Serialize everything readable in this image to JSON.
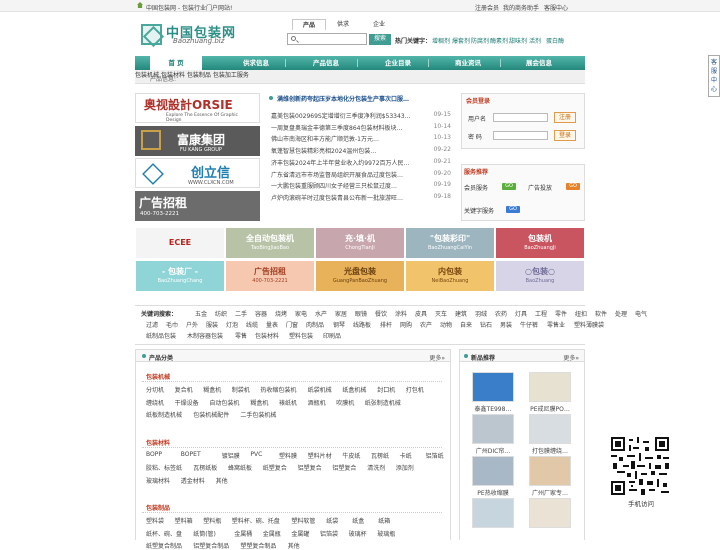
{
  "topbar": {
    "welcome": "中国包装网 - 包装行业门户网站!",
    "links": [
      "注册会员",
      "我的商务助手",
      "客服中心"
    ]
  },
  "logo": {
    "cn": "中国包装网",
    "en": "Baozhuang.biz"
  },
  "search": {
    "tabs": [
      "产品",
      "供求",
      "企业"
    ],
    "placeholder": "",
    "button": "搜索",
    "hot_label": "热门关键字：",
    "hot_words": [
      "增稠剂",
      "爆套剂",
      "防腐剂",
      "酶素剂",
      "甜味剂",
      "活剂",
      "蛋白酶"
    ]
  },
  "nav": [
    "首 页",
    "供求信息",
    "产品信息",
    "企业目录",
    "商业资讯",
    "展会信息"
  ],
  "subnav": {
    "label": "产品信息:",
    "items": [
      "包装机械",
      "包装材料",
      "包装制品",
      "包装加工服务"
    ]
  },
  "ads": [
    {
      "brand": "奥视設計ORSIE",
      "sub": "Explore The Essence Of Graphic Design",
      "bg": "#ffffff",
      "color": "#b0302a"
    },
    {
      "brand": "富康集团",
      "sub": "FU KANG GROUP",
      "bg": "#5a5a5a",
      "color": "#ffffff"
    },
    {
      "brand": "创立信",
      "sub": "WWW.CLXCN.COM",
      "bg": "#ffffff",
      "color": "#1d7fb0"
    },
    {
      "brand": "广告招租",
      "sub": "400-703-2221",
      "bg": "#6c6c6c",
      "color": "#ffffff"
    }
  ],
  "news": {
    "headline": "满维创新药夸起压岁本地化分包装生产事次口服…",
    "items": [
      {
        "title": "嘉美包装002969S定增增衍三季度净利润$53343…",
        "date": "09-15"
      },
      {
        "title": "一周复盘奥瑞金丰德第三季度864包装材料板块…",
        "date": "10-14"
      },
      {
        "title": "佛山市南海区和丰方能广顺范敦-1万元…",
        "date": "10-13"
      },
      {
        "title": "氧蓬智慧包装精彩亮相2024温州包装…",
        "date": "09-22"
      },
      {
        "title": "济丰包装2024年上半年营业收入约9972百万人民…",
        "date": "09-21"
      },
      {
        "title": "广东省清远市市场监督局组织开展食品过度包装…",
        "date": "09-20"
      },
      {
        "title": "一大鹏包装重服顾四川女子经营三只松鼠过度…",
        "date": "09-19"
      },
      {
        "title": "卢炉肉滚碗羊时过度包装青县公布新一批旅游旺…",
        "date": "09-18"
      }
    ]
  },
  "login": {
    "title": "会员登录",
    "user_label": "用户名",
    "pass_label": "密 码",
    "register": "注册",
    "login": "登录"
  },
  "service": {
    "title": "服务推荐",
    "items": [
      {
        "label": "会员服务",
        "badge": "GO",
        "color": "#5cae3c"
      },
      {
        "label": "广告投放",
        "badge": "GO",
        "color": "#e6832a"
      },
      {
        "label": "关键字服务",
        "badge": "GO",
        "color": "#3a7bd5"
      }
    ]
  },
  "tiles": [
    {
      "main": "ECEE",
      "sub": "",
      "bg": "#f4f4f4",
      "color": "#b3261e"
    },
    {
      "main": "全自动包装机",
      "sub": "TaoBingJiaoBao",
      "bg": "#b7c2a6",
      "color": "#ffffff"
    },
    {
      "main": "充·填·机",
      "sub": "ChongTianJi",
      "bg": "#c7a6ad",
      "color": "#ffffff"
    },
    {
      "main": "\"包装彩印\"",
      "sub": "BaoZhuangCaiYin",
      "bg": "#9cb5bf",
      "color": "#ffffff"
    },
    {
      "main": "包装机",
      "sub": "BaoZhuangJi",
      "bg": "#c85560",
      "color": "#ffffff"
    },
    {
      "main": "- 包装厂 -",
      "sub": "BaoZhuangChang",
      "bg": "#8fd4d6",
      "color": "#ffffff"
    },
    {
      "main": "广告招租",
      "sub": "400-703-2221",
      "bg": "#f6c8b0",
      "color": "#a24124"
    },
    {
      "main": "光盘包装",
      "sub": "GuangPanBaoZhuang",
      "bg": "#e8b25a",
      "color": "#6a4010"
    },
    {
      "main": "内包装",
      "sub": "NeiBaoZhuang",
      "bg": "#f1c36a",
      "color": "#7a4810"
    },
    {
      "main": "○包装○",
      "sub": "BaoZhuang",
      "bg": "#d6d4e6",
      "color": "#6f6c96"
    }
  ],
  "keywords": {
    "label": "关键词搜索：",
    "rows": [
      [
        "五金",
        "纺织",
        "二手",
        "容器",
        "烧烤",
        "家电",
        "水产",
        "家居",
        "眼镜",
        "餐饮",
        "涂料",
        "皮具",
        "灭车",
        "建筑",
        "羽绒",
        "农药",
        "灯具",
        "工程",
        "零件",
        "纽扣",
        "软件",
        "处理",
        "电气"
      ],
      [
        "过滤",
        "毛巾",
        "户外",
        "服装",
        "灯泡",
        "线缆",
        "量表",
        "门窗",
        "肉制品",
        "钢琴",
        "线路板",
        "排杆",
        "网购",
        "农产",
        "动物",
        "自来",
        "钻石",
        "男装",
        "牛仔裤",
        "零售业",
        "塑料薄膜袋"
      ],
      [
        "纸制品包装",
        "木制容器包装",
        "零售",
        "包装材料",
        "塑料包装",
        "印刷品"
      ]
    ]
  },
  "categories": {
    "title": "产品分类",
    "more": "更多»",
    "sections": [
      {
        "name": "包装机械",
        "rows": [
          [
            "分切机",
            "复合机",
            "糊盒机",
            "制袋机",
            "热收缩包装机",
            "纸袋机械",
            "纸盒机械",
            "封口机",
            "打包机"
          ],
          [
            "缠绕机",
            "干燥设备",
            "自动包装机",
            "糊盒机",
            "裱纸机",
            "酒瓶机",
            "吹膜机",
            "纸张制造机械"
          ],
          [
            "纸板制造机械",
            "包装机械配件",
            "二手包装机械"
          ]
        ]
      },
      {
        "name": "包装材料",
        "rows": [
          [
            "BOPP",
            "BOPET",
            "镀铝膜",
            "PVC",
            "塑料膜",
            "塑料片材",
            "牛皮纸",
            "瓦楞纸",
            "卡纸",
            "铝箔纸"
          ],
          [
            "胶粘、标签纸",
            "瓦楞纸板",
            "蜂窝纸板",
            "纸塑复合",
            "铝塑复合",
            "铝塑复合",
            "清洗剂",
            "添加剂"
          ],
          [
            "玻璃材料",
            "透金材料",
            "其他"
          ]
        ]
      },
      {
        "name": "包装制品",
        "rows": [
          [
            "塑料袋",
            "塑料箱",
            "塑料瓶",
            "塑料杯、碗、托盘",
            "塑料软管",
            "纸袋",
            "纸盒",
            "纸箱"
          ],
          [
            "纸杯、碗、盘",
            "纸筒(管)",
            "金属桶",
            "金属瓶",
            "金属罐",
            "铝箔袋",
            "玻璃杯",
            "玻璃瓶"
          ],
          [
            "纸塑复合制品",
            "铝塑复合制品",
            "塑塑复合制品",
            "其他"
          ]
        ]
      }
    ]
  },
  "recommend": {
    "title": "新品推荐",
    "more": "更多»",
    "items": [
      {
        "caption": "泰鑫TE998…",
        "color": "#3a7dc8"
      },
      {
        "caption": "PE戒尼膜PO…",
        "color": "#e7e1d2"
      },
      {
        "caption": "广州DIC帘…",
        "color": "#bcc6cf"
      },
      {
        "caption": "打包膜缠绕…",
        "color": "#d8dde2"
      },
      {
        "caption": "PE热收缩膜",
        "color": "#a9b8c6"
      },
      {
        "caption": "广州厂家专…",
        "color": "#e0c8a8"
      },
      {
        "caption": "",
        "color": "#c7d5de"
      },
      {
        "caption": "",
        "color": "#ebe2d6"
      }
    ]
  },
  "side_panel": "客服中心",
  "qr_caption": "手机访问"
}
